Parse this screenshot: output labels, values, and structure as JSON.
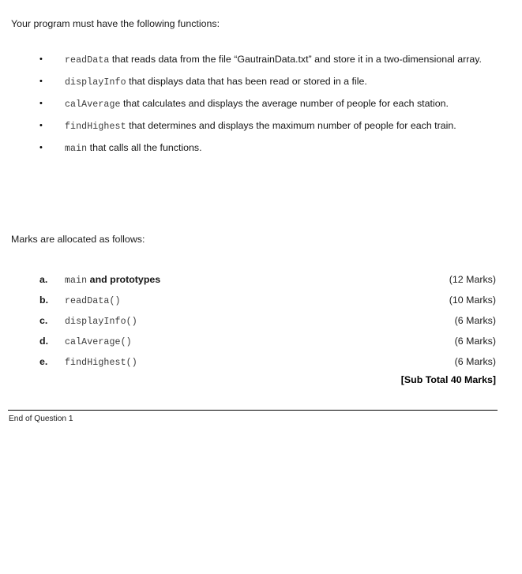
{
  "document": {
    "intro_functions": "Your program must have the following functions:",
    "intro_marks": "Marks are allocated as follows:",
    "bullet_glyph": "•",
    "functions": [
      {
        "name": "readData",
        "description": " that reads data from the file “GautrainData.txt” and store it in a two-dimensional array."
      },
      {
        "name": "displayInfo",
        "description": " that displays data that has been read or stored in a file."
      },
      {
        "name": "calAverage",
        "description": " that calculates and displays the average number of people for each station."
      },
      {
        "name": "findHighest",
        "description": " that determines and displays the maximum number of people for each train."
      },
      {
        "name": "main",
        "description": " that calls all the functions."
      }
    ],
    "marks": [
      {
        "letter": "a.",
        "code": "main",
        "suffix": " and prototypes",
        "value": "(12 Marks)"
      },
      {
        "letter": "b.",
        "code": "readData()",
        "suffix": "",
        "value": "(10 Marks)"
      },
      {
        "letter": "c.",
        "code": "displayInfo()",
        "suffix": "",
        "value": "(6 Marks)"
      },
      {
        "letter": "d.",
        "code": "calAverage()",
        "suffix": "",
        "value": "(6 Marks)"
      },
      {
        "letter": "e.",
        "code": "findHighest()",
        "suffix": "",
        "value": "(6 Marks)"
      }
    ],
    "subtotal": "[Sub Total 40 Marks]",
    "footer_text": "End of Question 1",
    "colors": {
      "body_text": "#161616",
      "code_text": "#3a3a3a",
      "rule": "#000000",
      "background": "#ffffff"
    }
  }
}
